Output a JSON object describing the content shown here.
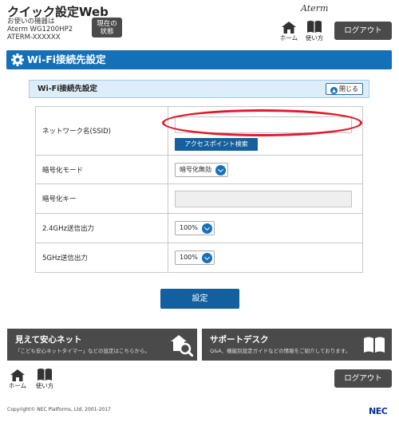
{
  "header": {
    "app_title": "クイック設定Web",
    "device_line1": "お使いの機器は",
    "device_line2": "Aterm WG1200HP2",
    "device_line3": "ATERM-XXXXXX",
    "status_button_line1": "現在の",
    "status_button_line2": "状態",
    "brand": "Aterm",
    "home_label": "ホーム",
    "help_label": "使い方",
    "logout_label": "ログアウト"
  },
  "page": {
    "title": "Wi-Fi接続先設定"
  },
  "section": {
    "title": "Wi-Fi接続先設定",
    "collapse_label": "閉じる"
  },
  "form": {
    "ssid_label": "ネットワーク名(SSID)",
    "ssid_value": "",
    "ap_search_label": "アクセスポイント検索",
    "encryption_mode_label": "暗号化モード",
    "encryption_mode_value": "暗号化無効",
    "encryption_key_label": "暗号化キー",
    "encryption_key_value": "",
    "power_24_label": "2.4GHz送信出力",
    "power_24_value": "100%",
    "power_5_label": "5GHz送信出力",
    "power_5_value": "100%",
    "submit_label": "設定"
  },
  "promos": [
    {
      "title": "見えて安心ネット",
      "description": "「こども安心ネットタイマー」などの設定はこちらから。",
      "icon": "house-magnifier-icon"
    },
    {
      "title": "サポートデスク",
      "description": "Q&A、機能別設定ガイドなどの情報をご紹介しております。",
      "icon": "book-icon"
    }
  ],
  "footer": {
    "home_label": "ホーム",
    "help_label": "使い方",
    "logout_label": "ログアウト",
    "copyright": "Copyright© NEC Platforms, Ltd. 2001-2017",
    "company_logo": "NEC"
  },
  "colors": {
    "primary_blue": "#1670b8",
    "dark_button": "#4a4a4a",
    "highlight_red": "#e3192a",
    "section_bg": "#ddeefa"
  }
}
